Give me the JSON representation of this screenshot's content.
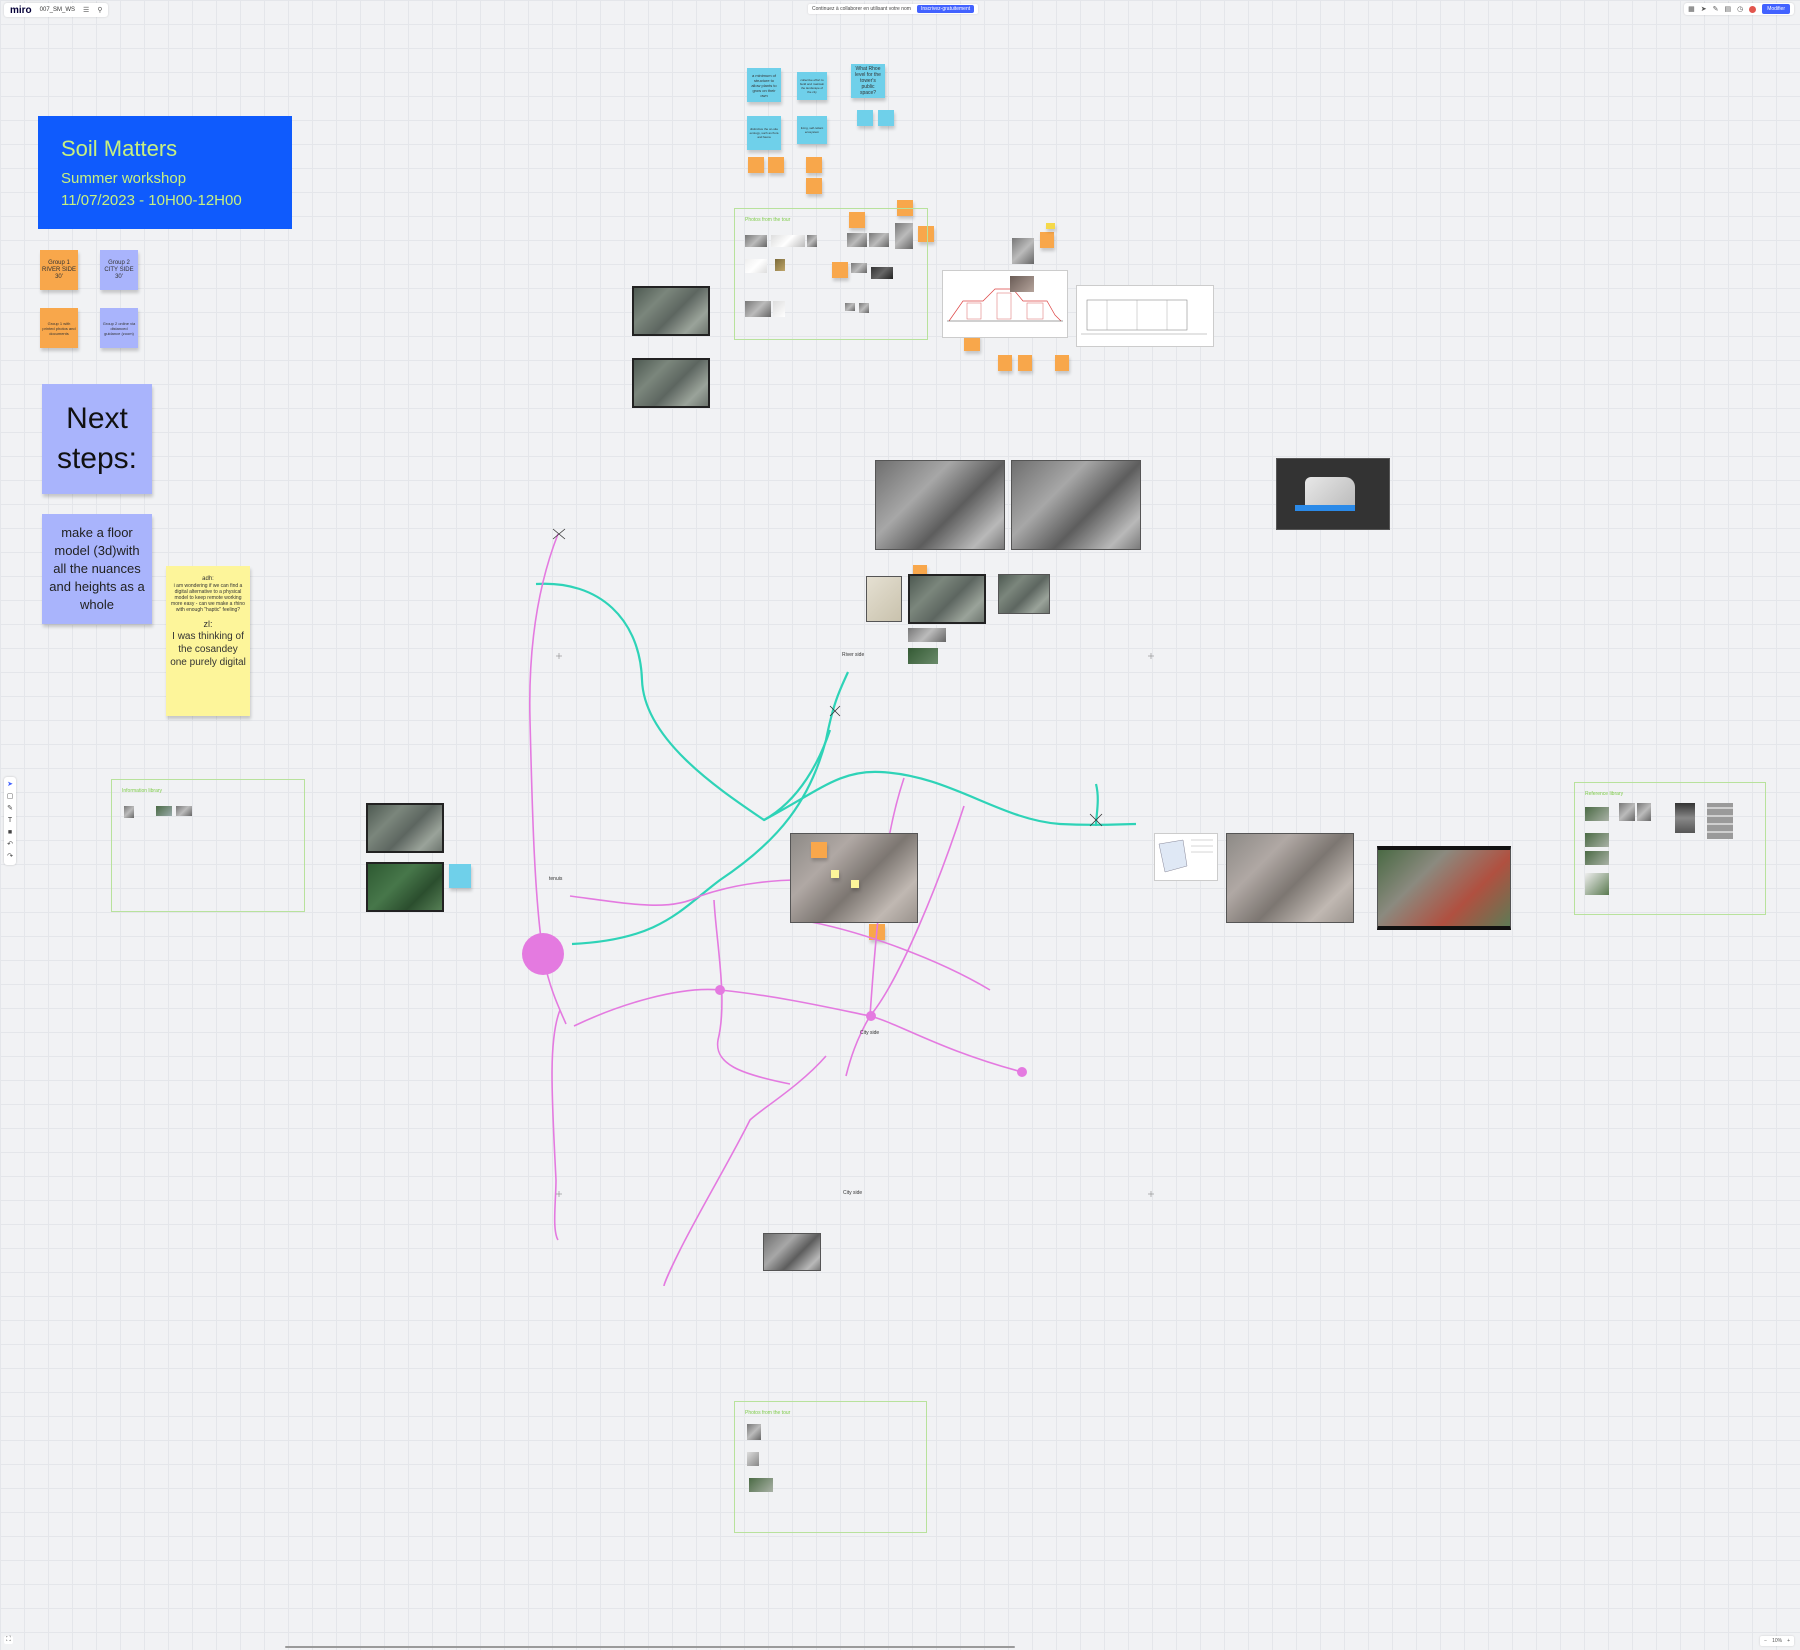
{
  "app": {
    "logo": "miro",
    "board_name": "007_SM_WS",
    "menu_icon": "hamburger-icon",
    "search_icon": "search-icon"
  },
  "banner": {
    "text": "Continuez à collaborer en utilisant votre nom",
    "button": "Inscrivez-gratuitement"
  },
  "topbar_right": {
    "share_label": "Modifier"
  },
  "title_card": {
    "title": "Soil Matters",
    "subtitle": "Summer workshop",
    "date": "11/07/2023 - 10H00-12H00",
    "bg_color": "#0f5bfd",
    "text_color": "#c6f080"
  },
  "group_stickies": [
    {
      "text": "Group 1 RIVER SIDE 30'"
    },
    {
      "text": "Group 2 CITY SIDE 30'"
    }
  ],
  "sub_stickies": [
    {
      "text": "Group 1 with printed photos and documents"
    },
    {
      "text": "Group 2 online via distanced guidance (zoom)"
    }
  ],
  "next_steps": {
    "title": "Next steps:",
    "body": "make a floor model (3d)with all the nuances and heights as a whole"
  },
  "yellow_note": {
    "line1": "adh:",
    "line2": "i am wondering if we can find a digital alternative to a physical model to keep remote working more easy - can we make a rhino with enough \"haptic\" feeling?",
    "line3": "zl:",
    "line4": "I was thinking of the cosandey one purely digital"
  },
  "blue_stickies": [
    {
      "text": "a minimum of structure to allow plants to grow on their own"
    },
    {
      "text": "collective effort to build and maintain the landscape of the city"
    },
    {
      "text": "What Rhoe level for the tower's public space?"
    },
    {
      "text": "distinctive the on-site ecology, such as flora and fauna"
    },
    {
      "text": "living, self-reliant ecosystem"
    }
  ],
  "map_labels": {
    "river_side": "River side",
    "city_side": "City side",
    "city_side_bottom": "City side",
    "tenuis": "tenuis"
  },
  "frames": {
    "top": "Photos from the tour",
    "left": "Information library",
    "right": "Reference library",
    "bottom": "Photos from the tour"
  },
  "bottom_right": {
    "zoom": "10%"
  },
  "colors": {
    "orange": "#f8a74b",
    "purple": "#a9b4fc",
    "blue": "#6fd0ea",
    "yellow": "#fdf59a",
    "teal_line": "#2ed3b7",
    "pink_line": "#e47ae0"
  }
}
